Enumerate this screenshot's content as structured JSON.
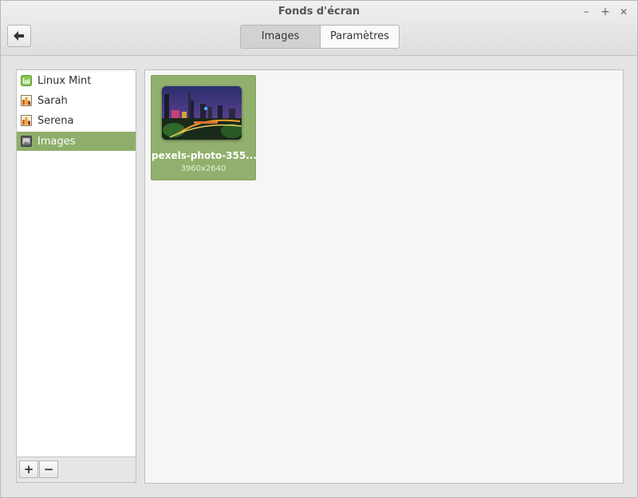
{
  "window": {
    "title": "Fonds d'écran",
    "controls": {
      "minimize": "–",
      "maximize": "+",
      "close": "✕"
    }
  },
  "toolbar": {
    "back_icon": "arrow-left-icon",
    "tabs": [
      {
        "label": "Images",
        "active": true
      },
      {
        "label": "Paramètres",
        "active": false
      }
    ]
  },
  "sidebar": {
    "items": [
      {
        "label": "Linux Mint",
        "icon": "mint-logo-icon"
      },
      {
        "label": "Sarah",
        "icon": "folder-image-icon"
      },
      {
        "label": "Serena",
        "icon": "folder-image-icon"
      },
      {
        "label": "Images",
        "icon": "pictures-folder-icon",
        "selected": true
      }
    ],
    "add_label": "+",
    "remove_label": "−"
  },
  "wallpapers": [
    {
      "name": "pexels-photo-355...",
      "dimensions": "3960x2640",
      "selected": true
    }
  ],
  "colors": {
    "selection": "#8fae6a",
    "accent_border": "#7f9f5d"
  }
}
